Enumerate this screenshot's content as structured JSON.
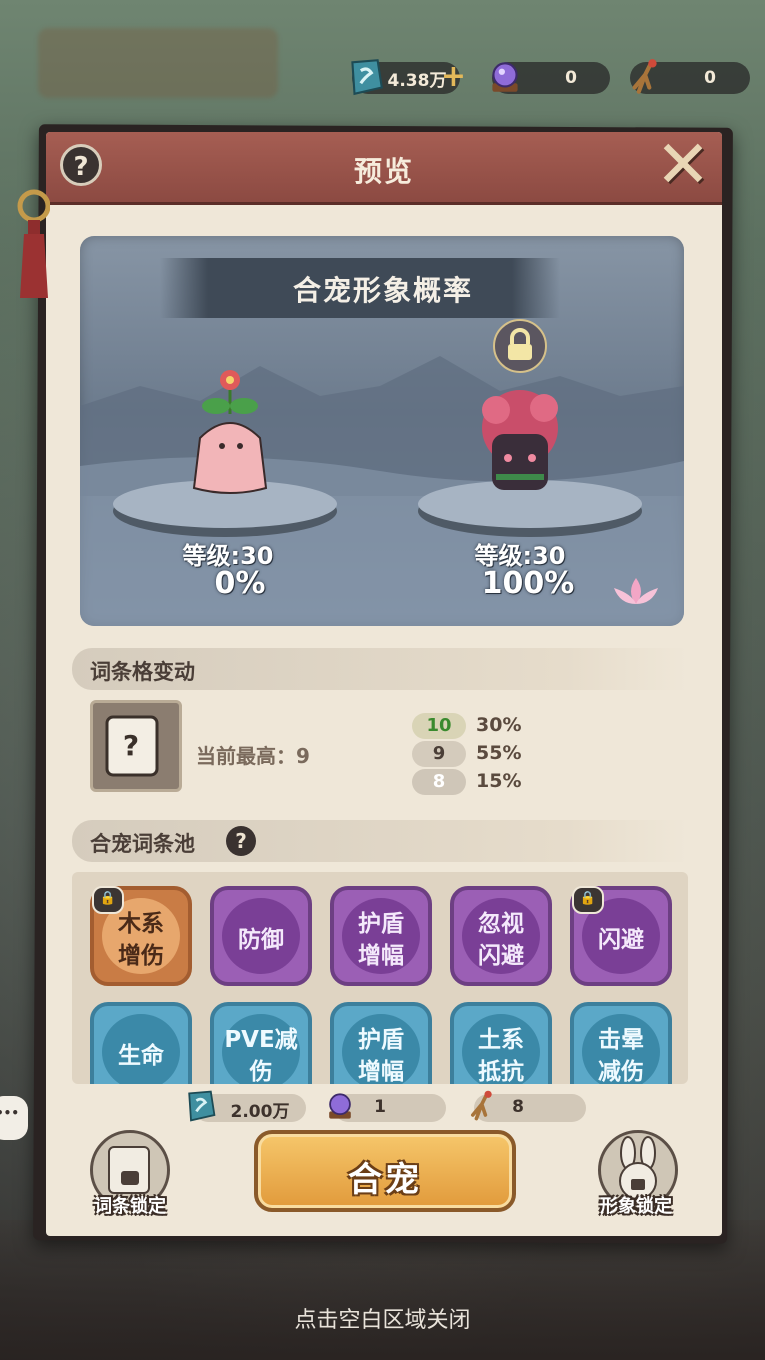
{
  "currencies": [
    {
      "name": "jade-stone",
      "value": "4.38万",
      "has_plus": true
    },
    {
      "name": "purple-orb",
      "value": "0",
      "has_plus": false
    },
    {
      "name": "ginseng",
      "value": "0",
      "has_plus": false
    }
  ],
  "panel": {
    "title": "预览",
    "help": "?",
    "close": "✕"
  },
  "preview": {
    "ribbon_title": "合宠形象概率",
    "left": {
      "level": "等级:30",
      "percent": "0%"
    },
    "right": {
      "level": "等级:30",
      "percent": "100%"
    }
  },
  "slot_change": {
    "header": "词条格变动",
    "current_max": "当前最高：9",
    "probabilities": [
      {
        "slots": "10",
        "percent": "30%",
        "color": "#3a8a2e"
      },
      {
        "slots": "9",
        "percent": "55%",
        "color": "#4a3e37"
      },
      {
        "slots": "8",
        "percent": "15%",
        "color": "#ffffff"
      }
    ]
  },
  "skill_pool": {
    "header": "合宠词条池",
    "help": "?",
    "row1": [
      {
        "label": "木系\n增伤",
        "color": "orange",
        "locked": true
      },
      {
        "label": "防御",
        "color": "purple",
        "locked": false
      },
      {
        "label": "护盾\n增幅",
        "color": "purple",
        "locked": false
      },
      {
        "label": "忽视\n闪避",
        "color": "purple",
        "locked": false
      },
      {
        "label": "闪避",
        "color": "purple",
        "locked": true
      }
    ],
    "row2": [
      {
        "label": "生命",
        "color": "blue",
        "locked": false
      },
      {
        "label": "PVE减\n伤",
        "color": "blue",
        "locked": false
      },
      {
        "label": "护盾\n增幅",
        "color": "blue",
        "locked": false
      },
      {
        "label": "土系\n抵抗",
        "color": "blue",
        "locked": false
      },
      {
        "label": "击晕\n减伤",
        "color": "blue",
        "locked": false
      }
    ]
  },
  "costs": [
    {
      "name": "jade-stone",
      "value": "2.00万"
    },
    {
      "name": "purple-orb",
      "value": "1"
    },
    {
      "name": "ginseng",
      "value": "8"
    }
  ],
  "buttons": {
    "merge": "合宠",
    "lock_entries": "词条锁定",
    "lock_appearance": "形象锁定"
  },
  "close_hint": "点击空白区域关闭"
}
